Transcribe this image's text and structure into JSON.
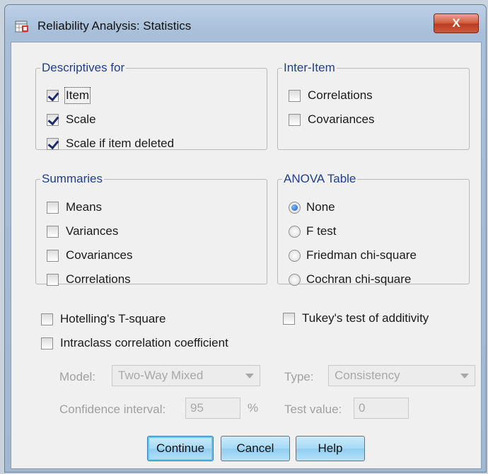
{
  "window": {
    "title": "Reliability Analysis: Statistics",
    "close_glyph": "X"
  },
  "descriptives": {
    "legend": "Descriptives for",
    "items": [
      {
        "label": "Item",
        "checked": true
      },
      {
        "label": "Scale",
        "checked": true
      },
      {
        "label": "Scale if item deleted",
        "checked": true
      }
    ]
  },
  "inter_item": {
    "legend": "Inter-Item",
    "items": [
      {
        "label": "Correlations",
        "checked": false
      },
      {
        "label": "Covariances",
        "checked": false
      }
    ]
  },
  "summaries": {
    "legend": "Summaries",
    "items": [
      {
        "label": "Means",
        "checked": false
      },
      {
        "label": "Variances",
        "checked": false
      },
      {
        "label": "Covariances",
        "checked": false
      },
      {
        "label": "Correlations",
        "checked": false
      }
    ]
  },
  "anova": {
    "legend": "ANOVA Table",
    "options": [
      {
        "label": "None",
        "selected": true
      },
      {
        "label": "F test",
        "selected": false
      },
      {
        "label": "Friedman chi-square",
        "selected": false
      },
      {
        "label": "Cochran chi-square",
        "selected": false
      }
    ]
  },
  "extras": {
    "hotelling": {
      "label": "Hotelling's T-square",
      "checked": false
    },
    "tukey": {
      "label": "Tukey's test of additivity",
      "checked": false
    },
    "intraclass": {
      "label": "Intraclass correlation coefficient",
      "checked": false
    }
  },
  "icc": {
    "model_label": "Model:",
    "model_value": "Two-Way Mixed",
    "type_label": "Type:",
    "type_value": "Consistency",
    "ci_label": "Confidence interval:",
    "ci_value": "95",
    "ci_unit": "%",
    "test_value_label": "Test value:",
    "test_value": "0"
  },
  "buttons": {
    "continue": "Continue",
    "cancel": "Cancel",
    "help": "Help"
  },
  "colors": {
    "legend_text": "#1f3f8a",
    "disabled_text": "#a0a0a0",
    "close_button": "#c94a2c"
  }
}
